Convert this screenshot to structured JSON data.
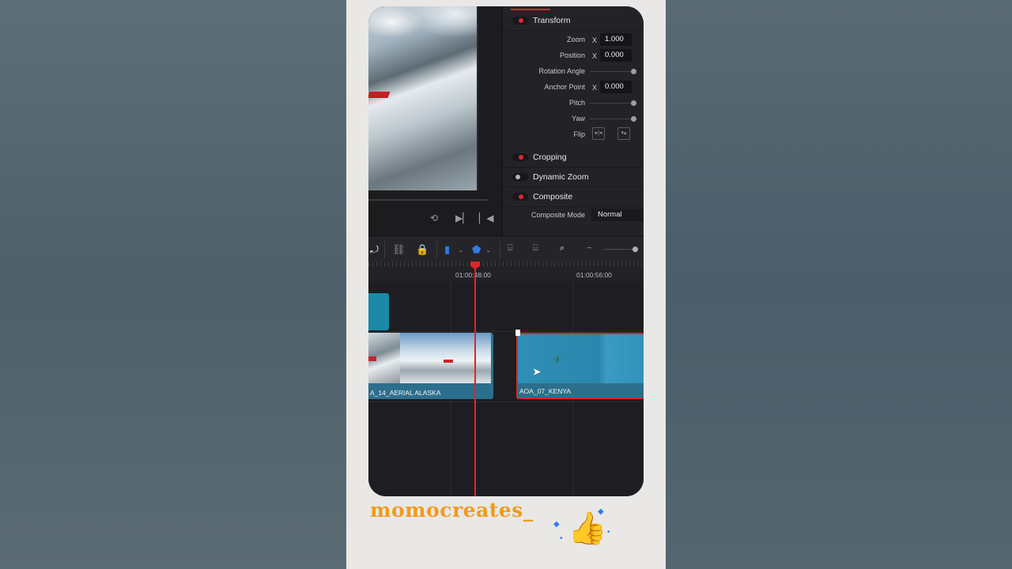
{
  "inspector": {
    "transform": "Transform",
    "cropping": "Cropping",
    "dynamic_zoom": "Dynamic Zoom",
    "composite": "Composite",
    "props": {
      "zoom_label": "Zoom",
      "zoom_axis": "X",
      "zoom_value": "1.000",
      "position_label": "Position",
      "position_axis": "X",
      "position_value": "0.000",
      "rotation_label": "Rotation Angle",
      "anchor_label": "Anchor Point",
      "anchor_axis": "X",
      "anchor_value": "0.000",
      "pitch_label": "Pitch",
      "yaw_label": "Yaw",
      "flip_label": "Flip",
      "composite_mode_label": "Composite Mode",
      "composite_mode_value": "Normal"
    }
  },
  "timeline": {
    "timecode_1": "01:00:48:00",
    "timecode_2": "01:00:56:00",
    "clip_a_name": "A_14_AERIAL ALASKA",
    "clip_b_name": "AOA_07_KENYA"
  },
  "brand": {
    "handle": "momocreates_"
  },
  "colors": {
    "accent_red": "#e0242b",
    "clip_blue": "#2c6f8c",
    "brand_orange": "#f29a1d"
  }
}
